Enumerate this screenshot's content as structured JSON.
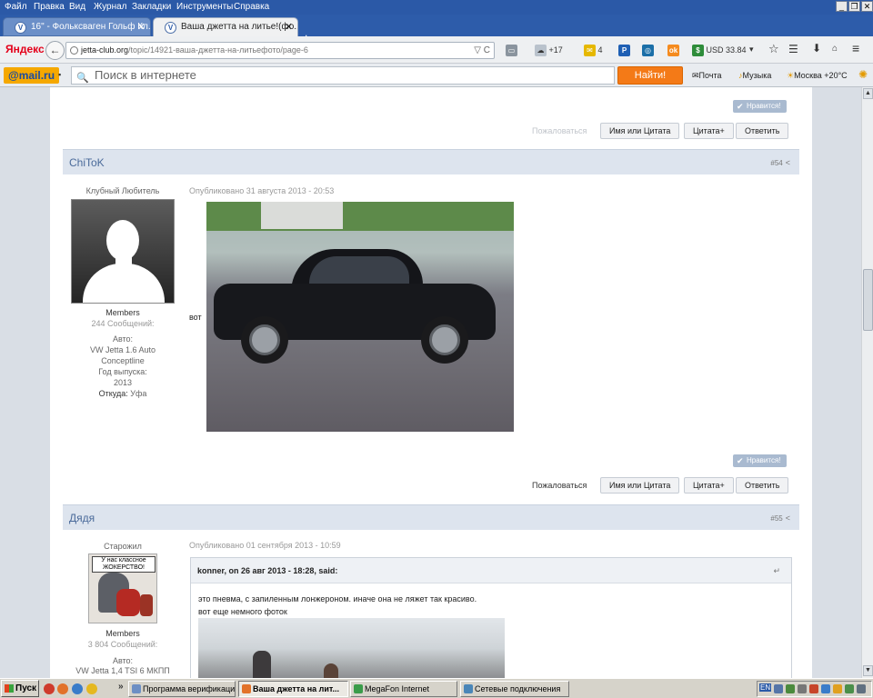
{
  "menu": [
    "Файл",
    "Правка",
    "Вид",
    "Журнал",
    "Закладки",
    "Инструменты",
    "Справка"
  ],
  "window_controls": [
    "_",
    "❐",
    "✕"
  ],
  "tabs": [
    {
      "title": "16\" - Фольксваген Гольф Кл...",
      "active": false
    },
    {
      "title": "Ваша джетта на литье!(фо...",
      "active": true
    }
  ],
  "newtab_label": "+",
  "navbar": {
    "logo": "Яндекс",
    "back_icon": "←",
    "url_domain": "jetta-club.org",
    "url_path": "/topic/14921-ваша-джетта-на-литьефото/page-6",
    "url_suffix": "▽ C",
    "weather": "+17",
    "mail_count": "4",
    "usd": "USD 33.84"
  },
  "mailbar": {
    "logo": "@mail.ru",
    "search_placeholder": "Поиск в интернете",
    "find_button": "Найти!",
    "mail_link": "Почта",
    "music_link": "Музыка",
    "weather_link": "Москва +20°C"
  },
  "post_prev": {
    "like": "Нравится!",
    "report": "Пожаловаться",
    "name_quote": "Имя или Цитата",
    "quote_plus": "Цитата+",
    "reply": "Ответить"
  },
  "post54": {
    "author": "ChiToK",
    "number": "#54",
    "user_title": "Клубный Любитель",
    "group": "Members",
    "posts": "244 Сообщений:",
    "auto_label": "Авто:",
    "auto_value": "VW Jetta 1.6 Auto",
    "auto_value2": "Conceptline",
    "year_label": "Год выпуска:",
    "year_value": "2013",
    "from_label": "Откуда:",
    "from_value": "Уфа",
    "published": "Опубликовано 31 августа 2013 - 20:53",
    "body_text": "вот",
    "like": "Нравится!",
    "report": "Пожаловаться",
    "name_quote": "Имя или Цитата",
    "quote_plus": "Цитата+",
    "reply": "Ответить"
  },
  "post55": {
    "author": "Дядя",
    "number": "#55",
    "user_title": "Старожил",
    "avatar_caption": "У нас классное ЖОКЕРСТВО!",
    "group": "Members",
    "posts": "3 804 Сообщений:",
    "auto_label": "Авто:",
    "auto_value": "VW Jetta 1,4 TSI 6 МКПП",
    "published": "Опубликовано 01 сентября 2013 - 10:59",
    "quote_header": "konner, on 26 авг 2013 - 18:28, said:",
    "quote_line1": "это пневма, с запиленным лонжероном. иначе она не ляжет так красиво.",
    "quote_line2": "вот еще немного фоток"
  },
  "taskbar": {
    "start": "Пуск",
    "chevron": "»",
    "buttons": [
      {
        "label": "Программа верификаци...",
        "active": false
      },
      {
        "label": "Ваша джетта на лит...",
        "active": true
      },
      {
        "label": "MegaFon Internet",
        "active": false
      },
      {
        "label": "Сетевые подключения",
        "active": false
      }
    ],
    "lang": "EN"
  },
  "colors": {
    "titlebar": "#2b59a7",
    "post_header": "#dde4ee",
    "author_link": "#4a6a9a",
    "find_button": "#f47a17",
    "like_button": "#a9bad0"
  }
}
